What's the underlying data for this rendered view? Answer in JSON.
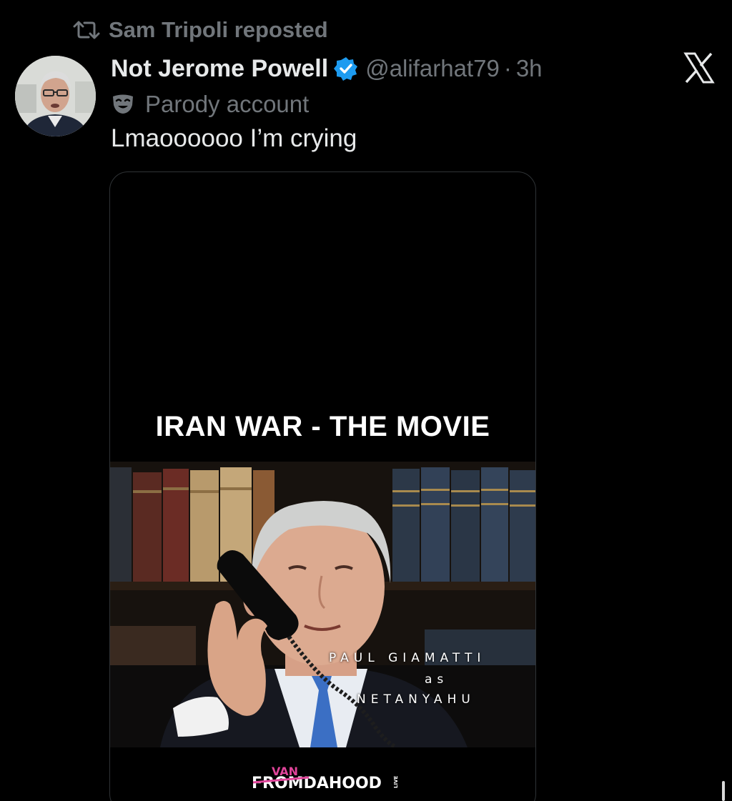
{
  "repost": {
    "icon": "repost-icon",
    "text": "Sam Tripoli reposted"
  },
  "tweet": {
    "display_name": "Not Jerome Powell",
    "verified_icon": "verified-badge-icon",
    "handle": "@alifarhat79",
    "separator": "·",
    "time": "3h",
    "parody_icon": "theater-mask-icon",
    "parody_label": "Parody account",
    "text": "Lmaoooooo I’m crying"
  },
  "media": {
    "title": "IRAN WAR - THE MOVIE",
    "credit_line1": "PAUL GIAMATTI",
    "credit_line2": "as",
    "credit_line3": "NETANYAHU",
    "watermark_top": "VAN",
    "watermark_main": "FROMDAHOOD",
    "watermark_side": "LIVE"
  },
  "close_icon": "x-logo-close-icon",
  "colors": {
    "background": "#000000",
    "text_primary": "#e7e9ea",
    "text_secondary": "#71767b",
    "verified_blue": "#1d9bf0",
    "card_border": "#2f3336",
    "watermark_pink": "#e0449a"
  }
}
